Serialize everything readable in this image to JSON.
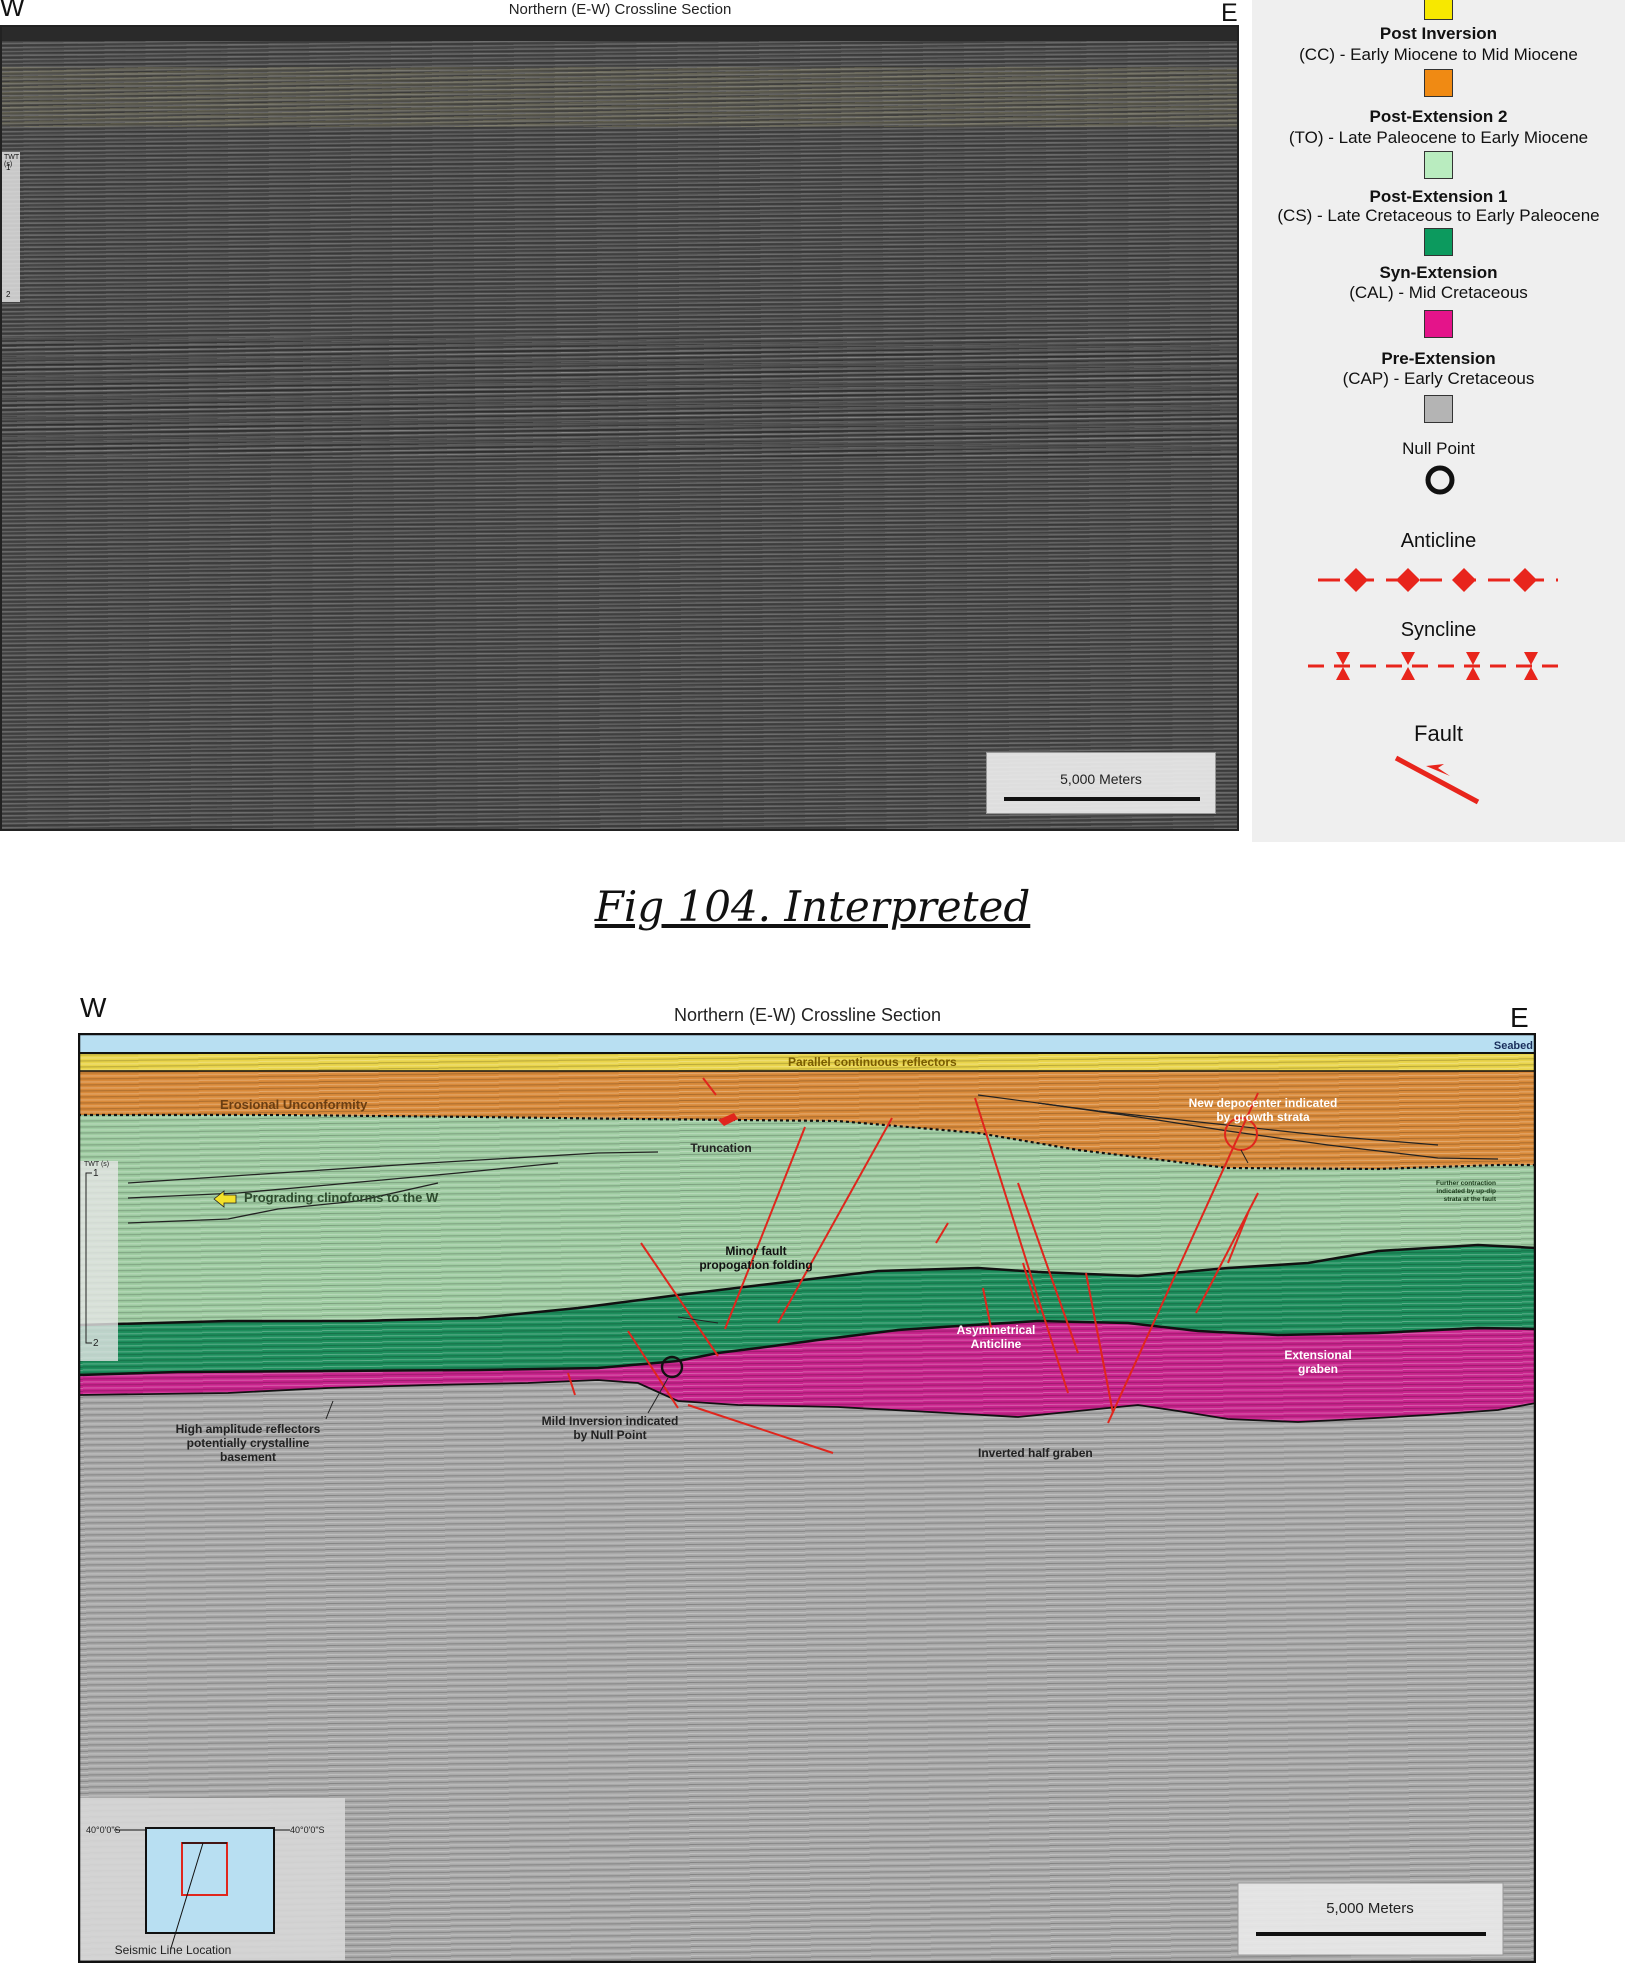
{
  "top_section": {
    "title": "Northern (E-W) Crossline Section",
    "west_label": "W",
    "east_label": "E",
    "twt_label": "TWT (s)",
    "twt_ticks": [
      "1",
      "2"
    ],
    "scale_label": "5,000 Meters"
  },
  "legend": {
    "units": [
      {
        "title": "Post Inversion",
        "subtitle": "(CC) - Early Miocene to Mid Miocene",
        "color": "#f7e800"
      },
      {
        "title": "Post-Extension 2",
        "subtitle": "(TO) - Late Paleocene to Early Miocene",
        "color": "#f08a13"
      },
      {
        "title": "Post-Extension 1",
        "subtitle": "(CS) - Late Cretaceous to Early Paleocene",
        "color": "#b9ecbf"
      },
      {
        "title": "Syn-Extension",
        "subtitle": "(CAL) - Mid Cretaceous",
        "color": "#0c9a5e"
      },
      {
        "title": "Pre-Extension",
        "subtitle": "(CAP) - Early Cretaceous",
        "color": "#e4148a"
      }
    ],
    "basement_color": "#b4b4b4",
    "null_point": "Null Point",
    "anticline": "Anticline",
    "syncline": "Syncline",
    "fault": "Fault",
    "symbol_color": "#e8251c"
  },
  "caption": "Fig 104. Interpreted",
  "bottom_section": {
    "title": "Northern (E-W) Crossline Section",
    "west_label": "W",
    "east_label": "E",
    "twt_label": "TWT (s)",
    "twt_ticks": [
      "1",
      "2"
    ],
    "scale_label": "5,000 Meters",
    "annotations": {
      "seabed": "Seabed",
      "parallel_reflectors": "Parallel continuous reflectors",
      "erosional_unconformity": "Erosional Unconformity",
      "new_depocenter_line1": "New depocenter indicated",
      "new_depocenter_line2": "by growth strata",
      "truncation": "Truncation",
      "prograding_clinoforms": "Prograding clinoforms to the W",
      "further_contraction_line1": "Further contraction",
      "further_contraction_line2": "indicated by up-dip",
      "further_contraction_line3": "strata at the fault",
      "minor_fault_line1": "Minor fault",
      "minor_fault_line2": "propogation folding",
      "asymmetrical_line1": "Asymmetrical",
      "asymmetrical_line2": "Anticline",
      "extensional_line1": "Extensional",
      "extensional_line2": "graben",
      "high_amp_line1": "High amplitude reflectors",
      "high_amp_line2": "potentially crystalline",
      "high_amp_line3": "basement",
      "mild_inversion_line1": "Mild Inversion indicated",
      "mild_inversion_line2": "by Null Point",
      "inverted_half_graben": "Inverted half graben"
    },
    "inset": {
      "lat_left": "40°0'0\"S",
      "lat_right": "40°0'0\"S",
      "caption": "Seismic Line Location"
    },
    "colors": {
      "sea": "#b8dff2",
      "post_inversion": "#e9d44a",
      "post_extension_2": "#d98a3a",
      "post_extension_1": "#9fcca2",
      "syn_extension": "#1d8e5c",
      "pre_extension": "#c8238c",
      "basement": "#a9a9a9",
      "fault": "#e0261d"
    }
  }
}
